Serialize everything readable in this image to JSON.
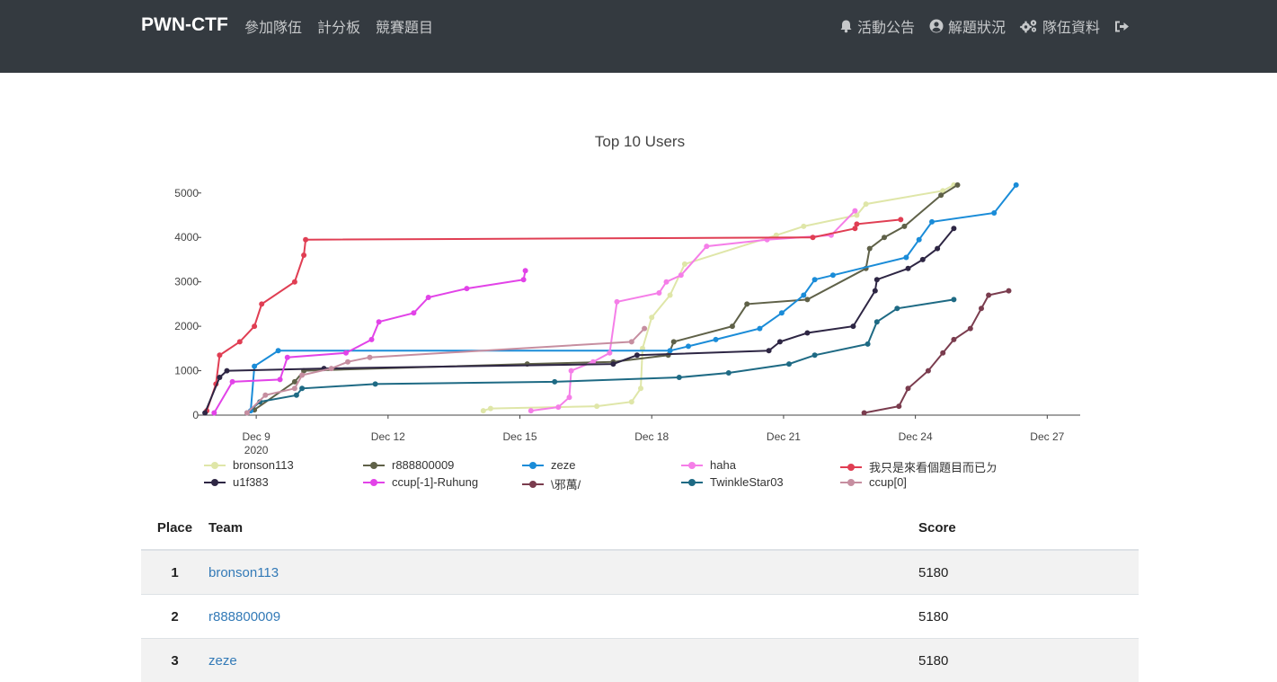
{
  "brand": "PWN-CTF",
  "nav": {
    "left": [
      "參加隊伍",
      "計分板",
      "競賽題目"
    ],
    "right": [
      {
        "icon": "bell-icon",
        "label": "活動公告"
      },
      {
        "icon": "user-circle-icon",
        "label": "解題狀況"
      },
      {
        "icon": "gears-icon",
        "label": "隊伍資料"
      },
      {
        "icon": "sign-out-icon",
        "label": ""
      }
    ]
  },
  "chart_data": {
    "type": "line",
    "title": "Top 10 Users",
    "xlabel": "",
    "ylabel": "",
    "x_ticks": [
      "Dec 9",
      "Dec 12",
      "Dec 15",
      "Dec 18",
      "Dec 21",
      "Dec 24",
      "Dec 27"
    ],
    "x_tick_sub": {
      "Dec 9": "2020"
    },
    "xlim": [
      "2020-12-07 18:00",
      "2020-12-27 18:00"
    ],
    "y_ticks": [
      0,
      1000,
      2000,
      3000,
      4000,
      5000
    ],
    "ylim": [
      0,
      5400
    ],
    "grid": false,
    "legend_position": "bottom",
    "series": [
      {
        "name": "bronson113",
        "color": "#dfe6a8",
        "points": [
          [
            "2020-12-14 04:00",
            100
          ],
          [
            "2020-12-14 08:00",
            150
          ],
          [
            "2020-12-16 18:00",
            200
          ],
          [
            "2020-12-17 13:00",
            300
          ],
          [
            "2020-12-17 18:00",
            600
          ],
          [
            "2020-12-17 19:00",
            1500
          ],
          [
            "2020-12-18 00:00",
            2200
          ],
          [
            "2020-12-18 10:00",
            2700
          ],
          [
            "2020-12-18 18:00",
            3400
          ],
          [
            "2020-12-20 20:00",
            4050
          ],
          [
            "2020-12-21 11:00",
            4250
          ],
          [
            "2020-12-22 16:00",
            4500
          ],
          [
            "2020-12-22 21:00",
            4750
          ],
          [
            "2020-12-24 15:00",
            5050
          ],
          [
            "2020-12-24 21:00",
            5180
          ]
        ]
      },
      {
        "name": "r888800009",
        "color": "#5f6148",
        "points": [
          [
            "2020-12-08 23:00",
            120
          ],
          [
            "2020-12-09 21:00",
            750
          ],
          [
            "2020-12-10 02:00",
            1000
          ],
          [
            "2020-12-15 04:00",
            1150
          ],
          [
            "2020-12-17 03:00",
            1200
          ],
          [
            "2020-12-18 09:00",
            1350
          ],
          [
            "2020-12-18 12:00",
            1650
          ],
          [
            "2020-12-19 20:00",
            2000
          ],
          [
            "2020-12-20 04:00",
            2500
          ],
          [
            "2020-12-21 13:00",
            2600
          ],
          [
            "2020-12-22 21:00",
            3300
          ],
          [
            "2020-12-22 23:00",
            3750
          ],
          [
            "2020-12-23 07:00",
            4000
          ],
          [
            "2020-12-23 18:00",
            4250
          ],
          [
            "2020-12-24 14:00",
            4950
          ],
          [
            "2020-12-24 23:00",
            5180
          ]
        ]
      },
      {
        "name": "zeze",
        "color": "#1a8cd8",
        "points": [
          [
            "2020-12-08 21:00",
            100
          ],
          [
            "2020-12-08 23:00",
            1100
          ],
          [
            "2020-12-09 12:00",
            1450
          ],
          [
            "2020-12-18 10:00",
            1450
          ],
          [
            "2020-12-18 20:00",
            1550
          ],
          [
            "2020-12-19 11:00",
            1700
          ],
          [
            "2020-12-20 11:00",
            1950
          ],
          [
            "2020-12-20 23:00",
            2300
          ],
          [
            "2020-12-21 11:00",
            2700
          ],
          [
            "2020-12-21 17:00",
            3050
          ],
          [
            "2020-12-22 03:00",
            3150
          ],
          [
            "2020-12-23 19:00",
            3550
          ],
          [
            "2020-12-24 02:00",
            3950
          ],
          [
            "2020-12-24 09:00",
            4350
          ],
          [
            "2020-12-25 19:00",
            4550
          ],
          [
            "2020-12-26 07:00",
            5180
          ]
        ]
      },
      {
        "name": "haha",
        "color": "#f57ee8",
        "points": [
          [
            "2020-12-15 06:00",
            100
          ],
          [
            "2020-12-15 21:00",
            180
          ],
          [
            "2020-12-16 03:00",
            400
          ],
          [
            "2020-12-16 04:00",
            1000
          ],
          [
            "2020-12-16 16:00",
            1200
          ],
          [
            "2020-12-17 01:00",
            1400
          ],
          [
            "2020-12-17 05:00",
            2550
          ],
          [
            "2020-12-18 04:00",
            2750
          ],
          [
            "2020-12-18 08:00",
            3000
          ],
          [
            "2020-12-18 16:00",
            3150
          ],
          [
            "2020-12-19 06:00",
            3800
          ],
          [
            "2020-12-20 15:00",
            3950
          ],
          [
            "2020-12-22 02:00",
            4050
          ],
          [
            "2020-12-22 15:00",
            4600
          ]
        ]
      },
      {
        "name": "我只是來看個題目而已ㄉ",
        "color": "#e03e53",
        "points": [
          [
            "2020-12-07 21:00",
            100
          ],
          [
            "2020-12-08 02:00",
            700
          ],
          [
            "2020-12-08 04:00",
            1350
          ],
          [
            "2020-12-08 15:00",
            1650
          ],
          [
            "2020-12-08 23:00",
            2000
          ],
          [
            "2020-12-09 03:00",
            2500
          ],
          [
            "2020-12-09 21:00",
            3000
          ],
          [
            "2020-12-10 02:00",
            3600
          ],
          [
            "2020-12-10 03:00",
            3950
          ],
          [
            "2020-12-21 16:00",
            4000
          ],
          [
            "2020-12-22 15:00",
            4200
          ],
          [
            "2020-12-22 16:00",
            4300
          ],
          [
            "2020-12-23 16:00",
            4400
          ]
        ]
      },
      {
        "name": "u1f383",
        "color": "#2e2644",
        "points": [
          [
            "2020-12-07 20:00",
            50
          ],
          [
            "2020-12-08 04:00",
            850
          ],
          [
            "2020-12-08 08:00",
            1000
          ],
          [
            "2020-12-10 13:00",
            1050
          ],
          [
            "2020-12-17 03:00",
            1150
          ],
          [
            "2020-12-17 16:00",
            1350
          ],
          [
            "2020-12-20 16:00",
            1450
          ],
          [
            "2020-12-20 22:00",
            1650
          ],
          [
            "2020-12-21 13:00",
            1850
          ],
          [
            "2020-12-22 14:00",
            2000
          ],
          [
            "2020-12-23 02:00",
            2800
          ],
          [
            "2020-12-23 03:00",
            3050
          ],
          [
            "2020-12-23 20:00",
            3300
          ],
          [
            "2020-12-24 04:00",
            3500
          ],
          [
            "2020-12-24 12:00",
            3750
          ],
          [
            "2020-12-24 21:00",
            4200
          ]
        ]
      },
      {
        "name": "ccup[-1]-Ruhung",
        "color": "#e243e8",
        "points": [
          [
            "2020-12-08 01:00",
            50
          ],
          [
            "2020-12-08 11:00",
            750
          ],
          [
            "2020-12-09 13:00",
            800
          ],
          [
            "2020-12-09 17:00",
            1300
          ],
          [
            "2020-12-11 01:00",
            1400
          ],
          [
            "2020-12-11 15:00",
            1700
          ],
          [
            "2020-12-11 19:00",
            2100
          ],
          [
            "2020-12-12 14:00",
            2300
          ],
          [
            "2020-12-12 22:00",
            2650
          ],
          [
            "2020-12-13 19:00",
            2850
          ],
          [
            "2020-12-15 02:00",
            3050
          ],
          [
            "2020-12-15 03:00",
            3250
          ]
        ]
      },
      {
        "name": "\\邪萬/",
        "color": "#7a3c4e",
        "points": [
          [
            "2020-12-22 20:00",
            50
          ],
          [
            "2020-12-23 15:00",
            200
          ],
          [
            "2020-12-23 20:00",
            600
          ],
          [
            "2020-12-24 07:00",
            1000
          ],
          [
            "2020-12-24 15:00",
            1400
          ],
          [
            "2020-12-24 21:00",
            1700
          ],
          [
            "2020-12-25 06:00",
            1950
          ],
          [
            "2020-12-25 12:00",
            2400
          ],
          [
            "2020-12-25 16:00",
            2700
          ],
          [
            "2020-12-26 03:00",
            2800
          ]
        ]
      },
      {
        "name": "TwinkleStar03",
        "color": "#1e6a84",
        "points": [
          [
            "2020-12-08 19:00",
            50
          ],
          [
            "2020-12-09 02:00",
            300
          ],
          [
            "2020-12-09 22:00",
            450
          ],
          [
            "2020-12-10 01:00",
            600
          ],
          [
            "2020-12-11 17:00",
            700
          ],
          [
            "2020-12-15 19:00",
            750
          ],
          [
            "2020-12-18 15:00",
            850
          ],
          [
            "2020-12-19 18:00",
            950
          ],
          [
            "2020-12-21 03:00",
            1150
          ],
          [
            "2020-12-21 17:00",
            1350
          ],
          [
            "2020-12-22 22:00",
            1600
          ],
          [
            "2020-12-23 03:00",
            2100
          ],
          [
            "2020-12-23 14:00",
            2400
          ],
          [
            "2020-12-24 21:00",
            2600
          ]
        ]
      },
      {
        "name": "ccup[0]",
        "color": "#c68ea0",
        "points": [
          [
            "2020-12-08 19:00",
            50
          ],
          [
            "2020-12-09 05:00",
            450
          ],
          [
            "2020-12-09 21:00",
            600
          ],
          [
            "2020-12-10 01:00",
            900
          ],
          [
            "2020-12-10 17:00",
            1050
          ],
          [
            "2020-12-11 02:00",
            1200
          ],
          [
            "2020-12-11 14:00",
            1300
          ],
          [
            "2020-12-17 13:00",
            1650
          ],
          [
            "2020-12-17 20:00",
            1950
          ]
        ]
      }
    ]
  },
  "table": {
    "headers": {
      "place": "Place",
      "team": "Team",
      "score": "Score"
    },
    "rows": [
      {
        "place": "1",
        "team": "bronson113",
        "score": "5180"
      },
      {
        "place": "2",
        "team": "r888800009",
        "score": "5180"
      },
      {
        "place": "3",
        "team": "zeze",
        "score": "5180"
      }
    ]
  }
}
